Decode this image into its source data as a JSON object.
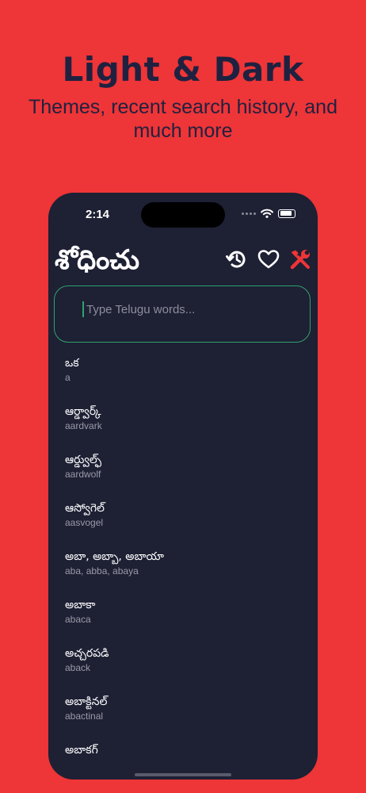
{
  "promo": {
    "headline": "Light & Dark",
    "subline": "Themes, recent search history, and much more"
  },
  "status_bar": {
    "time": "2:14"
  },
  "app": {
    "title": "శోధించు",
    "toolbar": {
      "history_icon": "history-icon",
      "favorite_icon": "heart-icon",
      "settings_icon": "tools-icon"
    },
    "accent_color": "#2FA36E",
    "settings_color": "#EE3537"
  },
  "search": {
    "placeholder": "Type Telugu words...",
    "value": ""
  },
  "words": [
    {
      "te": "ఒక",
      "en": "a"
    },
    {
      "te": "ఆర్డ్వార్క్",
      "en": "aardvark"
    },
    {
      "te": "ఆర్డ్వుల్ఫ్",
      "en": "aardwolf"
    },
    {
      "te": "ఆస్వోగెల్",
      "en": "aasvogel"
    },
    {
      "te": "అబా, అబ్బా, అబాయా",
      "en": "aba, abba, abaya"
    },
    {
      "te": "అబాకా",
      "en": "abaca"
    },
    {
      "te": "అచ్చరపడి",
      "en": "aback"
    },
    {
      "te": "అబాక్టినల్",
      "en": "abactinal"
    },
    {
      "te": "అబాకగ్",
      "en": ""
    }
  ]
}
